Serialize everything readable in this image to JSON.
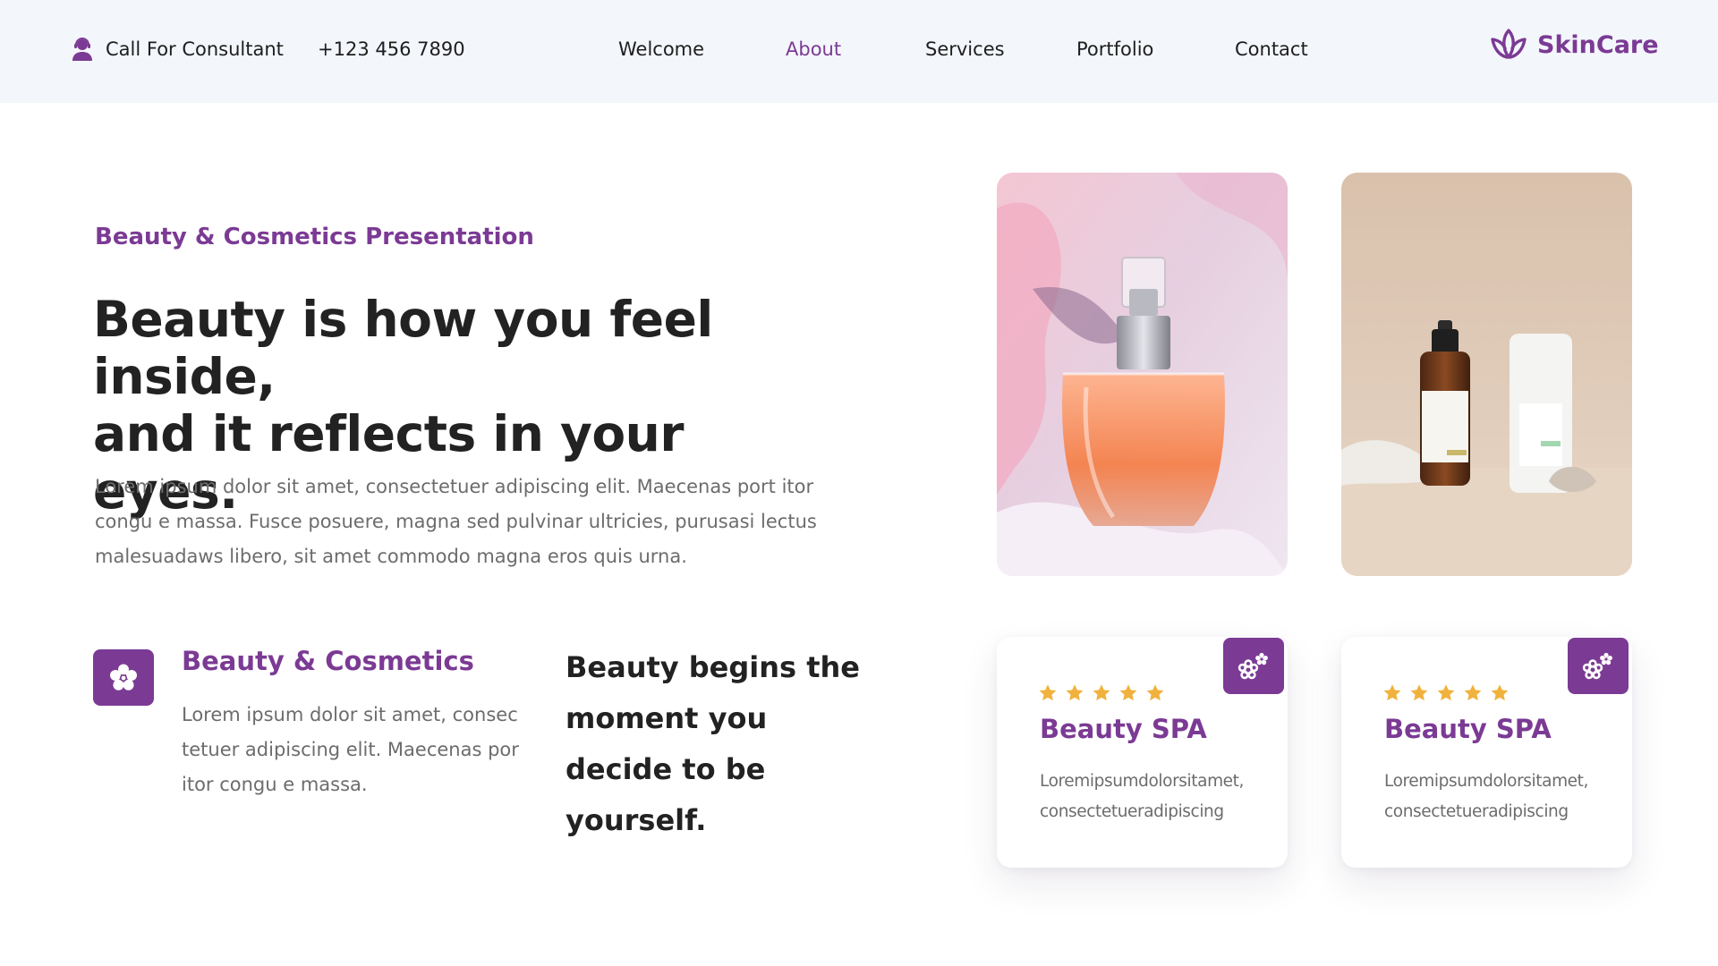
{
  "header": {
    "consult_label": "Call For Consultant",
    "phone": "+123 456 7890",
    "nav": [
      {
        "label": "Welcome",
        "active": false
      },
      {
        "label": "About",
        "active": true
      },
      {
        "label": "Services",
        "active": false
      },
      {
        "label": "Portfolio",
        "active": false
      },
      {
        "label": "Contact",
        "active": false
      }
    ],
    "brand": "SkinCare",
    "consult_icon": "user-headset-icon",
    "brand_icon": "lotus-icon"
  },
  "hero": {
    "eyebrow": "Beauty & Cosmetics Presentation",
    "headline_line1": "Beauty is how you feel inside,",
    "headline_line2": "and it reflects in your eyes.",
    "intro": "Lorem ipsum dolor sit amet, consectetuer adipiscing elit. Maecenas port itor congu e massa. Fusce posuere, magna sed pulvinar ultricies, purusasi lectus malesuadaws libero, sit amet commodo magna eros quis urna."
  },
  "feature": {
    "icon": "flower-icon",
    "title": "Beauty & Cosmetics",
    "text": "Lorem ipsum dolor sit amet, consec tetuer adipiscing elit. Maecenas por itor congu e massa."
  },
  "quote": "Beauty begins the moment you decide to be yourself.",
  "photos": [
    {
      "subject": "perfume-bottle-photo"
    },
    {
      "subject": "serum-bottles-photo"
    }
  ],
  "cards": [
    {
      "rating": 5,
      "title": "Beauty SPA",
      "text": "Loremipsumdolorsitamet, consectetueradipiscing",
      "icon": "flowers-icon"
    },
    {
      "rating": 5,
      "title": "Beauty SPA",
      "text": "Loremipsumdolorsitamet, consectetueradipiscing",
      "icon": "flowers-icon"
    }
  ],
  "colors": {
    "accent": "#7b3a94",
    "star": "#f0b23d",
    "header_bg": "#f3f6fb",
    "heading": "#222222",
    "body_text": "#6c6c6c"
  }
}
